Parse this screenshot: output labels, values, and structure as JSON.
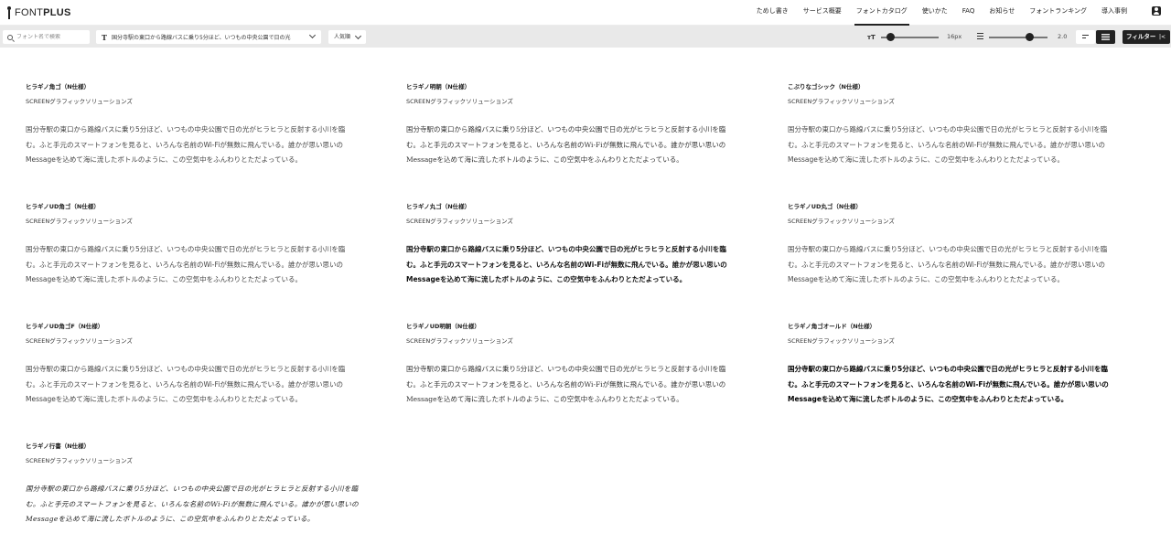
{
  "header": {
    "logo": {
      "mark_icon": "font-plus-mark-icon",
      "text_thin": "FONT",
      "text_bold": "PLUS"
    },
    "nav": [
      {
        "label": "ためし書き",
        "active": false
      },
      {
        "label": "サービス概要",
        "active": false
      },
      {
        "label": "フォントカタログ",
        "active": true
      },
      {
        "label": "使いかた",
        "active": false
      },
      {
        "label": "FAQ",
        "active": false
      },
      {
        "label": "お知らせ",
        "active": false
      },
      {
        "label": "フォントランキング",
        "active": false
      },
      {
        "label": "導入事例",
        "active": false
      }
    ],
    "account_icon": "account-icon"
  },
  "toolbar": {
    "search": {
      "placeholder": "フォント名で検索",
      "value": ""
    },
    "sample_text": "国分寺駅の東口から路線バスに乗り5分ほど、いつもの中央公園で日の光",
    "sort": {
      "selected": "人気順"
    },
    "font_size": {
      "value": "16px",
      "level": 0.12
    },
    "line_height": {
      "value": "2.0",
      "level": 0.72
    },
    "filter_label": "フィルター",
    "filter_close": "|<"
  },
  "fonts": [
    {
      "name": "ヒラギノ角ゴ（N仕様）",
      "foundry": "SCREENグラフィックソリューションズ",
      "style": "st-light"
    },
    {
      "name": "ヒラギノ明朝（N仕様）",
      "foundry": "SCREENグラフィックソリューションズ",
      "style": "st-serif"
    },
    {
      "name": "こぶりなゴシック（N仕様）",
      "foundry": "SCREENグラフィックソリューションズ",
      "style": "st-light"
    },
    {
      "name": "ヒラギノUD角ゴ（N仕様）",
      "foundry": "SCREENグラフィックソリューションズ",
      "style": "st-light"
    },
    {
      "name": "ヒラギノ丸ゴ（N仕様）",
      "foundry": "SCREENグラフィックソリューションズ",
      "style": "st-bold"
    },
    {
      "name": "ヒラギノUD丸ゴ（N仕様）",
      "foundry": "SCREENグラフィックソリューションズ",
      "style": "st-light"
    },
    {
      "name": "ヒラギノUD角ゴF（N仕様）",
      "foundry": "SCREENグラフィックソリューションズ",
      "style": "st-light"
    },
    {
      "name": "ヒラギノUD明朝（N仕様）",
      "foundry": "SCREENグラフィックソリューションズ",
      "style": "st-serif"
    },
    {
      "name": "ヒラギノ角ゴオールド（N仕様）",
      "foundry": "SCREENグラフィックソリューションズ",
      "style": "st-heavy"
    },
    {
      "name": "ヒラギノ行書（N仕様）",
      "foundry": "SCREENグラフィックソリューションズ",
      "style": "st-brush"
    }
  ],
  "sample_lines": [
    "国分寺駅の東口から路線バスに乗り5分ほど、いつもの中央公園で日の光がヒラヒラと反射する小川を臨",
    "む。ふと手元のスマートフォンを見ると、いろんな名前のWi-Fiが無数に飛んでいる。誰かが思い思いの",
    "Messageを込めて海に流したボトルのように、この空気中をふんわりとただよっている。"
  ]
}
